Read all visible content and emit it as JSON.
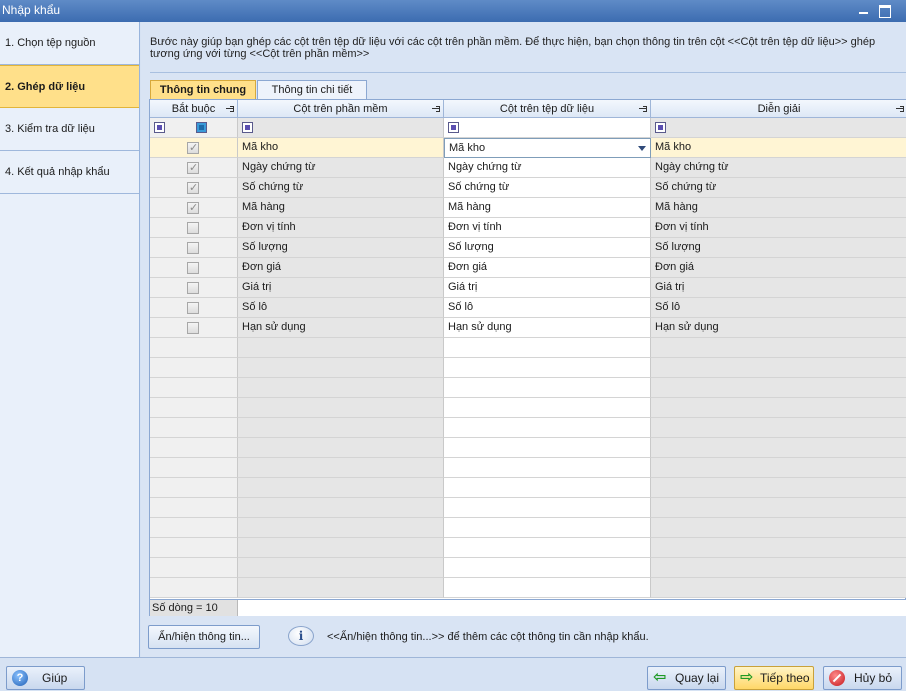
{
  "window": {
    "title": "Nhập khẩu"
  },
  "steps": [
    {
      "label": "1. Chọn tệp nguồn"
    },
    {
      "label": "2. Ghép dữ liệu"
    },
    {
      "label": "3. Kiểm tra dữ liệu"
    },
    {
      "label": "4. Kết quả nhập khẩu"
    }
  ],
  "description": {
    "line1": "Bước này giúp bạn ghép các cột trên tệp dữ liệu với các cột trên phần mềm. Để thực hiện, bạn chọn thông tin trên cột <<Cột trên tệp dữ liệu>> ghép",
    "line2": "tương ứng với từng <<Cột trên phần mềm>>"
  },
  "tabs": [
    {
      "label": "Thông tin chung"
    },
    {
      "label": "Thông tin chi tiết"
    }
  ],
  "grid": {
    "headers": [
      "Bắt buộc",
      "Cột trên phần mềm",
      "Cột trên tệp dữ liệu",
      "Diễn giải"
    ],
    "rows": [
      {
        "required": true,
        "software": "Mã kho",
        "file": "Mã kho",
        "desc": "Mã kho"
      },
      {
        "required": true,
        "software": "Ngày chứng từ",
        "file": "Ngày chứng từ",
        "desc": "Ngày chứng từ"
      },
      {
        "required": true,
        "software": "Số chứng từ",
        "file": "Số chứng từ",
        "desc": "Số chứng từ"
      },
      {
        "required": true,
        "software": "Mã hàng",
        "file": "Mã hàng",
        "desc": "Mã hàng"
      },
      {
        "required": false,
        "software": "Đơn vị tính",
        "file": "Đơn vị tính",
        "desc": "Đơn vị tính"
      },
      {
        "required": false,
        "software": "Số lượng",
        "file": "Số lượng",
        "desc": "Số lượng"
      },
      {
        "required": false,
        "software": "Đơn giá",
        "file": "Đơn giá",
        "desc": "Đơn giá"
      },
      {
        "required": false,
        "software": "Giá trị",
        "file": "Giá trị",
        "desc": "Giá trị"
      },
      {
        "required": false,
        "software": "Số lô",
        "file": "Số lô",
        "desc": "Số lô"
      },
      {
        "required": false,
        "software": "Hạn sử dụng",
        "file": "Hạn sử dụng",
        "desc": "Hạn sử dụng"
      }
    ],
    "row_count": "Số dòng = 10"
  },
  "toggle_button": {
    "label": "Ẩn/hiện thông tin..."
  },
  "info": {
    "text": "<<Ẩn/hiện thông tin...>> để thêm các cột thông tin cần nhập khẩu."
  },
  "buttons": {
    "help": "Giúp",
    "back": "Quay lại",
    "next": "Tiếp theo",
    "cancel": "Hủy bỏ"
  }
}
